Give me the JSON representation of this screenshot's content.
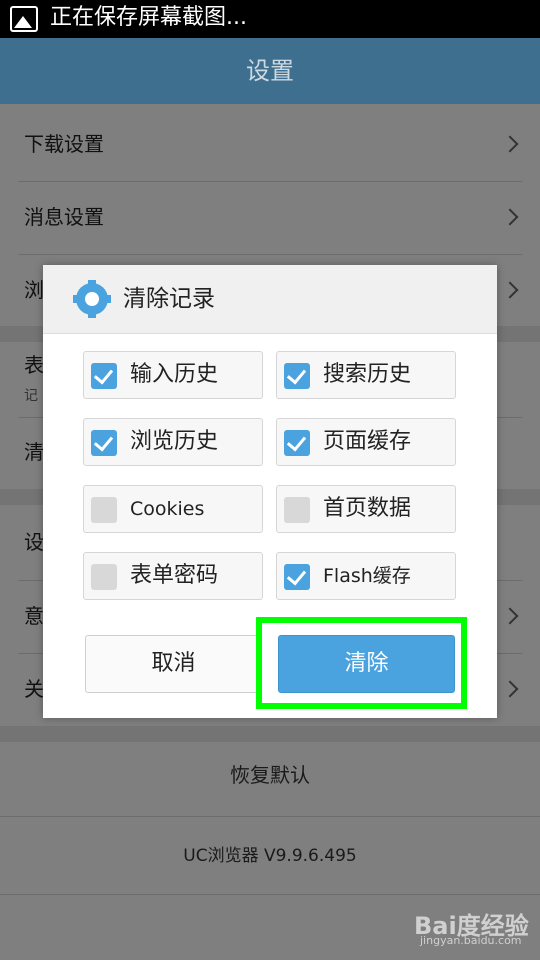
{
  "status_bar": {
    "icon": "image-icon",
    "text": "正在保存屏幕截图..."
  },
  "header": {
    "title": "设置"
  },
  "settings": {
    "rows": [
      {
        "label": "下载设置"
      },
      {
        "label": "消息设置"
      },
      {
        "label": "浏"
      },
      {
        "label": "表"
      },
      {
        "label": "记"
      },
      {
        "label": "清"
      },
      {
        "label": "设"
      },
      {
        "label": "意"
      },
      {
        "label": "关"
      }
    ],
    "restore_defaults": "恢复默认",
    "version": "UC浏览器  V9.9.6.495"
  },
  "dialog": {
    "title": "清除记录",
    "icon": "gear-icon",
    "options": [
      {
        "label": "输入历史",
        "checked": true
      },
      {
        "label": "搜索历史",
        "checked": true
      },
      {
        "label": "浏览历史",
        "checked": true
      },
      {
        "label": "页面缓存",
        "checked": true
      },
      {
        "label": "Cookies",
        "checked": false
      },
      {
        "label": "首页数据",
        "checked": false
      },
      {
        "label": "表单密码",
        "checked": false
      },
      {
        "label": "Flash缓存",
        "checked": true
      }
    ],
    "cancel_label": "取消",
    "clear_label": "清除"
  },
  "watermark": {
    "main": "Bai度经验",
    "sub": "jingyan.baidu.com"
  },
  "colors": {
    "accent": "#4aa3df",
    "highlight": "#00ff00",
    "titlebar": "#3e6f8e"
  }
}
